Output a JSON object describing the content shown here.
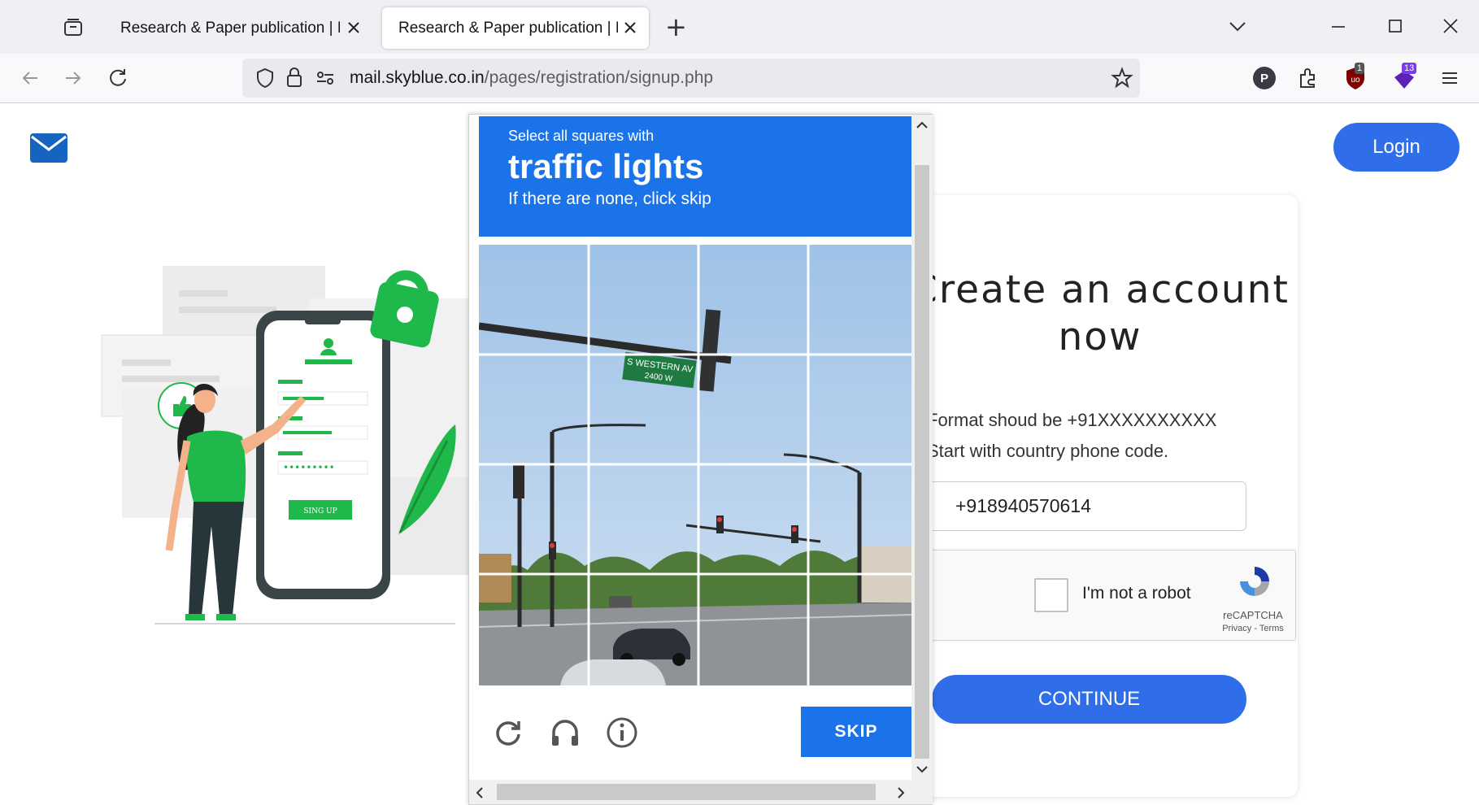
{
  "browser": {
    "tabs": [
      {
        "title": "Research & Paper publication | Mail",
        "active": false
      },
      {
        "title": "Research & Paper publication | Mail",
        "active": true
      }
    ],
    "new_tab_label": "+",
    "url_host": "mail.skyblue.co.in",
    "url_path": "/pages/registration/signup.php",
    "extension_badges": {
      "ublock": "1",
      "extension": "13"
    },
    "profile_initial": "P"
  },
  "header": {
    "login_label": "Login"
  },
  "signup": {
    "heading": "Create an account now",
    "format_hint": "Format shoud be +91XXXXXXXXXX",
    "country_hint": "Start with country phone code.",
    "phone_value": "+918940570614",
    "recaptcha_label": "I'm not a robot",
    "recaptcha_brand": "reCAPTCHA",
    "recaptcha_links": "Privacy - Terms",
    "continue_label": "CONTINUE"
  },
  "illustration": {
    "signup_button_text": "SING UP"
  },
  "challenge": {
    "line1": "Select all squares with",
    "target": "traffic lights",
    "line3": "If there are none, click skip",
    "grid_rows": 4,
    "grid_cols": 4,
    "street_sign": "S WESTERN AV",
    "street_sign_number": "2400 W",
    "skip_label": "SKIP"
  },
  "colors": {
    "accent": "#2f6ee8",
    "captcha_blue": "#1a73e8",
    "illustration_green": "#1fb84a"
  },
  "icons": [
    "mail-icon",
    "reload-icon",
    "audio-icon",
    "info-icon",
    "recaptcha-logo-icon"
  ]
}
